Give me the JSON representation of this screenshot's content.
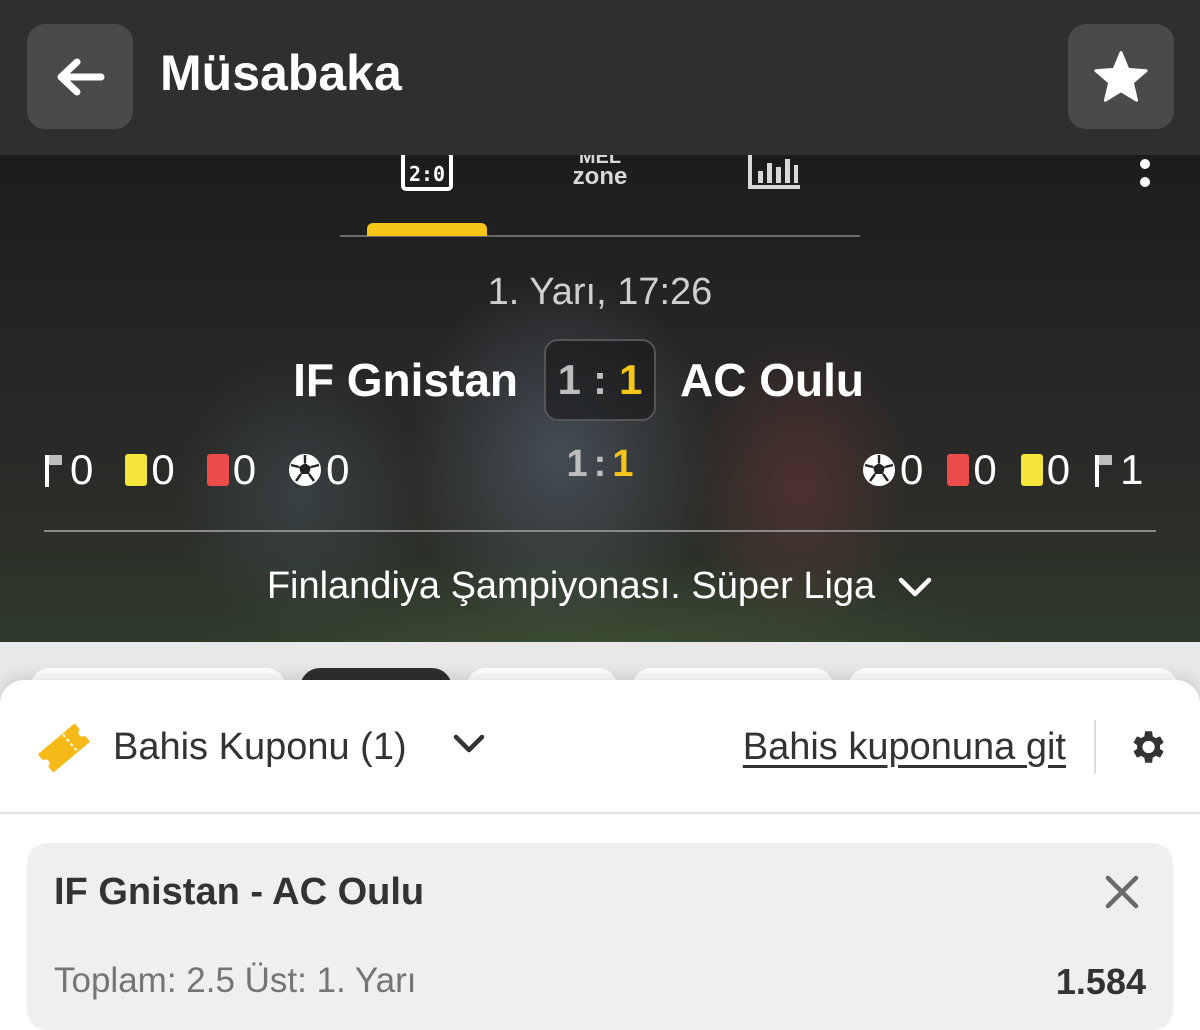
{
  "header": {
    "title": "Müsabaka",
    "back_icon": "arrow-left-icon",
    "favorite_icon": "star-icon"
  },
  "tabs": [
    {
      "name": "scoreboard",
      "icon": "scoreboard-icon",
      "active": true
    },
    {
      "name": "mel-zone",
      "label_top": "MEL",
      "label_bottom": "zone",
      "active": false
    },
    {
      "name": "statistics",
      "icon": "bar-chart-icon",
      "active": false
    }
  ],
  "match": {
    "period": "1. Yarı, 17:26",
    "home_team": "IF Gnistan",
    "away_team": "AC Oulu",
    "score": {
      "home": "1",
      "sep": ":",
      "away": "1"
    },
    "half_score": {
      "home": "1",
      "sep": ":",
      "away": "1"
    },
    "home_stats": {
      "corners": "0",
      "yellow_cards": "0",
      "red_cards": "0",
      "goals": "0"
    },
    "away_stats": {
      "goals": "0",
      "red_cards": "0",
      "yellow_cards": "0",
      "corners": "1"
    },
    "league": "Finlandiya Şampiyonası. Süper Liga"
  },
  "bet_slip": {
    "label": "Bahis Kuponu (1)",
    "goto_link": "Bahis kuponuna git",
    "bet": {
      "match": "IF Gnistan - AC Oulu",
      "market": "Toplam: 2.5 Üst: 1. Yarı",
      "odds": "1.584"
    }
  },
  "colors": {
    "accent_yellow": "#f5c518",
    "header_bg": "#2f2f2f",
    "yellow_card": "#f5e43a",
    "red_card": "#ee4b4b"
  }
}
